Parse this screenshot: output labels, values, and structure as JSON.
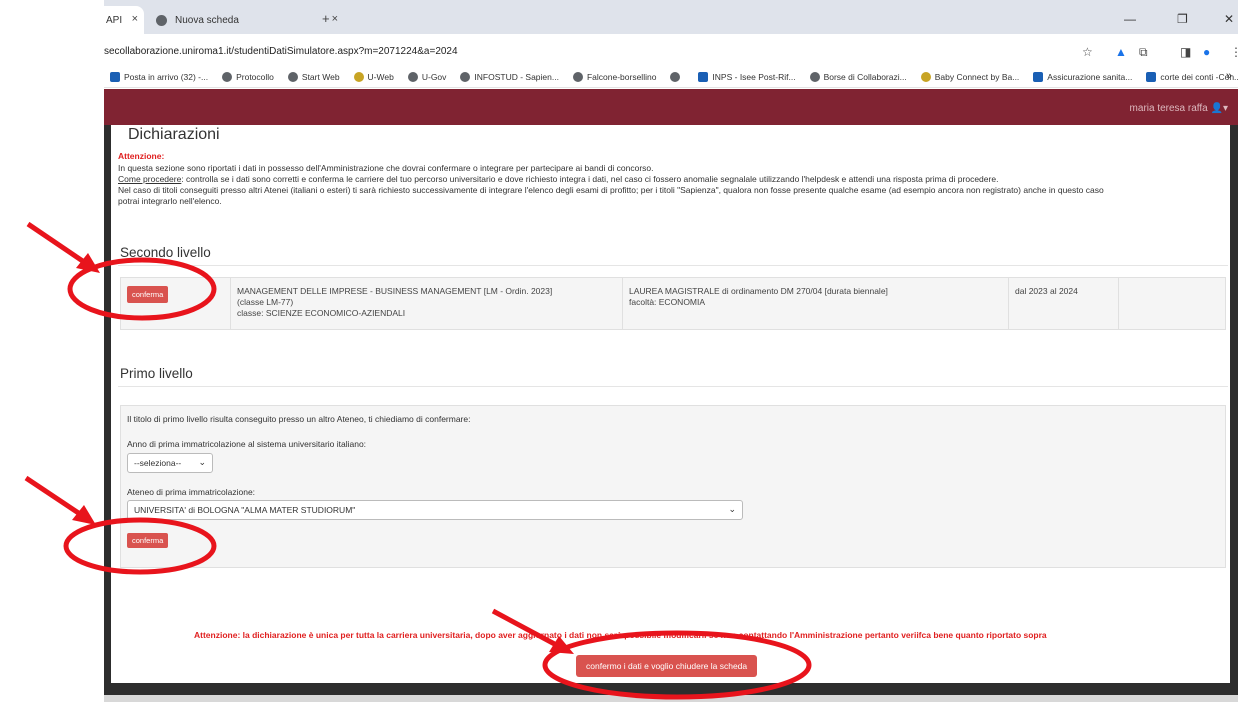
{
  "browser": {
    "active_tab_title": "API",
    "inactive_tab_title": "Nuova scheda",
    "close_glyph": "×",
    "new_tab_glyph": "+",
    "url": "secollaborazione.uniroma1.it/studentiDatiSimulatore.aspx?m=2071224&a=2024",
    "bookmarks": [
      {
        "label": "Posta in arrivo (32) -..."
      },
      {
        "label": "Protocollo"
      },
      {
        "label": "Start Web"
      },
      {
        "label": "U-Web"
      },
      {
        "label": "U-Gov"
      },
      {
        "label": "INFOSTUD - Sapien..."
      },
      {
        "label": "Falcone-borsellino"
      },
      {
        "label": ""
      },
      {
        "label": "INPS - Isee Post-Rif..."
      },
      {
        "label": "Borse di Collaborazi..."
      },
      {
        "label": "Baby Connect by Ba..."
      },
      {
        "label": "Assicurazione sanita..."
      },
      {
        "label": "corte dei conti -Con..."
      }
    ],
    "more_glyph": "»"
  },
  "header": {
    "user_name": "maria teresa raffa"
  },
  "page": {
    "title": "Dichiarazioni",
    "warning_label": "Attenzione:",
    "intro_line1": "In questa sezione sono riportati i dati in possesso dell'Amministrazione che dovrai confermare o integrare per partecipare ai bandi di concorso.",
    "how_label": "Come procedere",
    "intro_line2": ": controlla se i dati sono corretti e conferma le carriere del tuo percorso universitario e dove richiesto integra i dati, nel caso ci fossero anomalie segnalale utilizzando l'helpdesk e attendi una risposta prima di procedere.",
    "intro_line3": "Nel caso di titoli conseguiti presso altri Atenei (italiani o esteri) ti sarà richiesto successivamente di integrare l'elenco degli esami di profitto; per i titoli \"Sapienza\", qualora non fosse presente qualche esame (ad esempio ancora non registrato) anche in questo caso",
    "intro_line4": "potrai integrarlo nell'elenco."
  },
  "second_level": {
    "heading": "Secondo livello",
    "confirm_label": "conferma",
    "course_line1": "MANAGEMENT DELLE IMPRESE - BUSINESS MANAGEMENT [LM - Ordin. 2023]",
    "course_line2": "(classe LM-77)",
    "course_line3": "classe: SCIENZE ECONOMICO-AZIENDALI",
    "degree_line1": "LAUREA MAGISTRALE di ordinamento DM 270/04 [durata biennale]",
    "degree_line2": "facoltà: ECONOMIA",
    "period": "dal 2023 al 2024"
  },
  "first_level": {
    "heading": "Primo livello",
    "notice": "Il titolo di primo livello risulta conseguito presso un altro Ateneo, ti chiediamo di confermare:",
    "year_label": "Anno di prima immatricolazione al sistema universitario italiano:",
    "year_value": "--seleziona--",
    "university_label": "Ateneo di prima immatricolazione:",
    "university_value": "UNIVERSITA' di BOLOGNA \"ALMA MATER STUDIORUM\"",
    "confirm_label": "conferma"
  },
  "footer": {
    "warning": "Attenzione: la dichiarazione è unica per tutta la carriera universitaria, dopo aver aggiornato i dati non sarà possibile modificarli se non contattando l'Amministrazione pertanto veriifca bene quanto riportato sopra",
    "final_button": "confermo i dati e voglio chiudere la scheda"
  },
  "colors": {
    "brand": "#802332",
    "button": "#d9534f",
    "warning": "#e02020",
    "annotation": "#e8141c"
  },
  "icons": [
    "close-icon",
    "star-icon",
    "extensions-icon",
    "profile-icon",
    "user-icon",
    "chevron-down-icon",
    "arrow-annotation"
  ]
}
